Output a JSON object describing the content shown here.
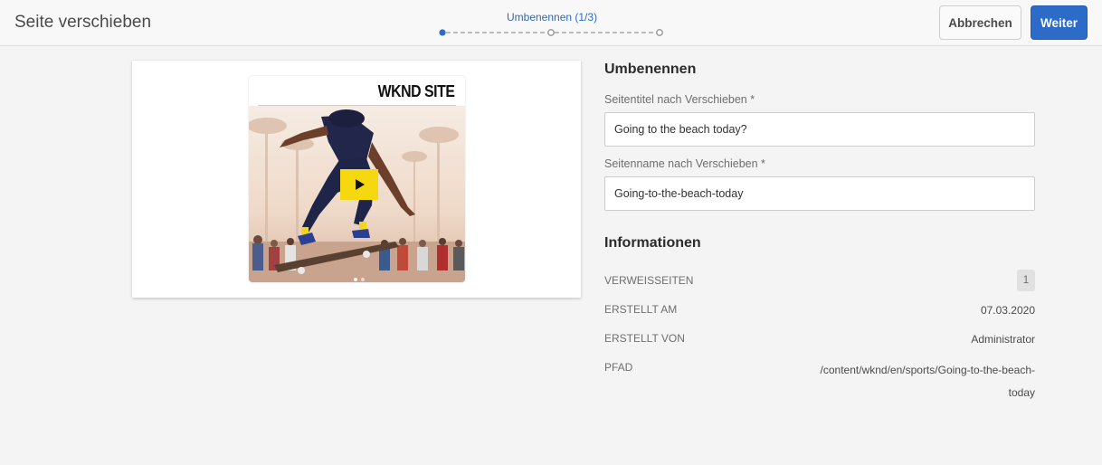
{
  "header": {
    "title": "Seite verschieben",
    "step_label": "Umbenennen (1/3)",
    "cancel_label": "Abbrechen",
    "next_label": "Weiter"
  },
  "wizard": {
    "total_steps": 3,
    "current_step": 1,
    "active_color": "#2d6bc8"
  },
  "preview": {
    "brand": "WKND SITE",
    "play_icon": "play-icon"
  },
  "rename": {
    "title": "Umbenennen",
    "page_title_label": "Seitentitel nach Verschieben *",
    "page_title_value": "Going to the beach today?",
    "page_name_label": "Seitenname nach Verschieben *",
    "page_name_value": "Going-to-the-beach-today"
  },
  "info": {
    "title": "Informationen",
    "references_label": "VERWEISSEITEN",
    "references_value": "1",
    "created_label": "ERSTELLT AM",
    "created_value": "07.03.2020",
    "created_by_label": "ERSTELLT VON",
    "created_by_value": "Administrator",
    "path_label": "PFAD",
    "path_value": "/content/wknd/en/sports/Going-to-the-beach-today"
  }
}
